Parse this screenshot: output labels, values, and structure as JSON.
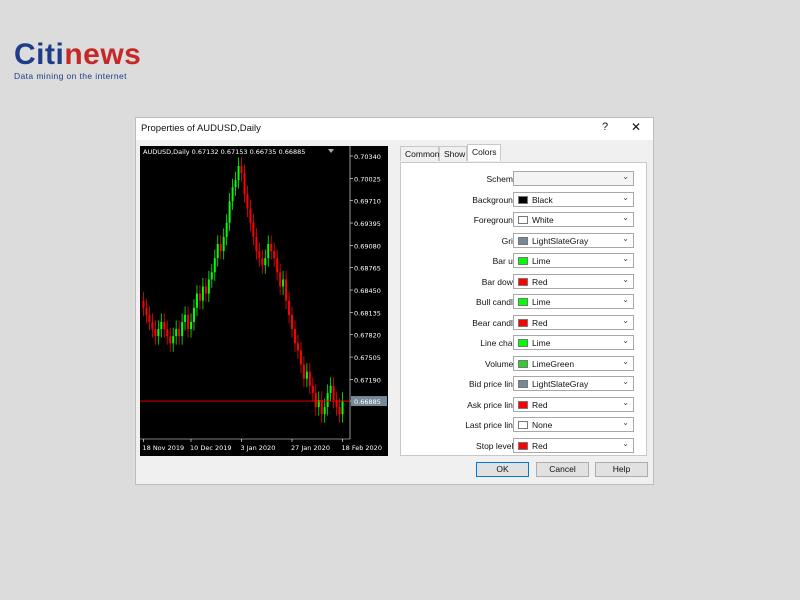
{
  "logo": {
    "brand_part1": "Citi",
    "brand_part2": "news",
    "tagline": "Data mining on the internet"
  },
  "dialog": {
    "title": "Properties of AUDUSD,Daily",
    "help_glyph": "?",
    "close_glyph": "✕",
    "tabs": [
      {
        "label": "Common"
      },
      {
        "label": "Show"
      },
      {
        "label": "Colors",
        "active": true
      }
    ],
    "rows": [
      {
        "label": "Scheme:",
        "value": "",
        "swatch": "",
        "disabled": true
      },
      {
        "label": "Background:",
        "value": "Black",
        "swatch": "#000000"
      },
      {
        "label": "Foreground:",
        "value": "White",
        "swatch": "#ffffff"
      },
      {
        "label": "Grid:",
        "value": "LightSlateGray",
        "swatch": "#778899"
      },
      {
        "label": "Bar up:",
        "value": "Lime",
        "swatch": "#00ff00"
      },
      {
        "label": "Bar down:",
        "value": "Red",
        "swatch": "#ff0000"
      },
      {
        "label": "Bull candle:",
        "value": "Lime",
        "swatch": "#00ff00"
      },
      {
        "label": "Bear candle:",
        "value": "Red",
        "swatch": "#ff0000"
      },
      {
        "label": "Line chart:",
        "value": "Lime",
        "swatch": "#00ff00"
      },
      {
        "label": "Volumes:",
        "value": "LimeGreen",
        "swatch": "#32cd32"
      },
      {
        "label": "Bid price line:",
        "value": "LightSlateGray",
        "swatch": "#778899"
      },
      {
        "label": "Ask price line:",
        "value": "Red",
        "swatch": "#ff0000"
      },
      {
        "label": "Last price line:",
        "value": "None",
        "swatch": "#ffffff"
      },
      {
        "label": "Stop levels:",
        "value": "Red",
        "swatch": "#ff0000"
      }
    ],
    "buttons": {
      "ok": "OK",
      "cancel": "Cancel",
      "help": "Help"
    },
    "chevron_glyph": "⌄"
  },
  "chart_data": {
    "type": "candlestick",
    "title": "AUDUSD,Daily 0.67132 0.67153 0.66735 0.66885",
    "y_ticks": [
      "0.70340",
      "0.70025",
      "0.69710",
      "0.69395",
      "0.69080",
      "0.68765",
      "0.68450",
      "0.68135",
      "0.67820",
      "0.67505",
      "0.67190",
      "0.66885"
    ],
    "ylim": [
      0.6635,
      0.7034
    ],
    "x_ticks": [
      "18 Nov 2019",
      "10 Dec 2019",
      "3 Jan 2020",
      "27 Jan 2020",
      "18 Feb 2020"
    ],
    "x_tick_index": [
      0,
      16,
      33,
      50,
      67
    ],
    "current_price": 0.66885,
    "colors": {
      "background": "#000000",
      "foreground": "#ffffff",
      "bull": "#00ff00",
      "bear": "#ff0000",
      "bid_line": "#778899",
      "price_label_bg": "#778899"
    },
    "close": [
      0.682,
      0.681,
      0.68,
      0.679,
      0.678,
      0.679,
      0.68,
      0.679,
      0.678,
      0.677,
      0.678,
      0.679,
      0.678,
      0.68,
      0.681,
      0.679,
      0.68,
      0.682,
      0.684,
      0.683,
      0.685,
      0.684,
      0.686,
      0.687,
      0.689,
      0.691,
      0.69,
      0.692,
      0.694,
      0.697,
      0.699,
      0.7,
      0.702,
      0.701,
      0.698,
      0.696,
      0.694,
      0.692,
      0.69,
      0.689,
      0.688,
      0.689,
      0.691,
      0.69,
      0.689,
      0.687,
      0.685,
      0.686,
      0.683,
      0.681,
      0.679,
      0.677,
      0.676,
      0.674,
      0.672,
      0.673,
      0.671,
      0.67,
      0.668,
      0.669,
      0.667,
      0.668,
      0.67,
      0.671,
      0.669,
      0.668,
      0.667,
      0.6689
    ]
  }
}
